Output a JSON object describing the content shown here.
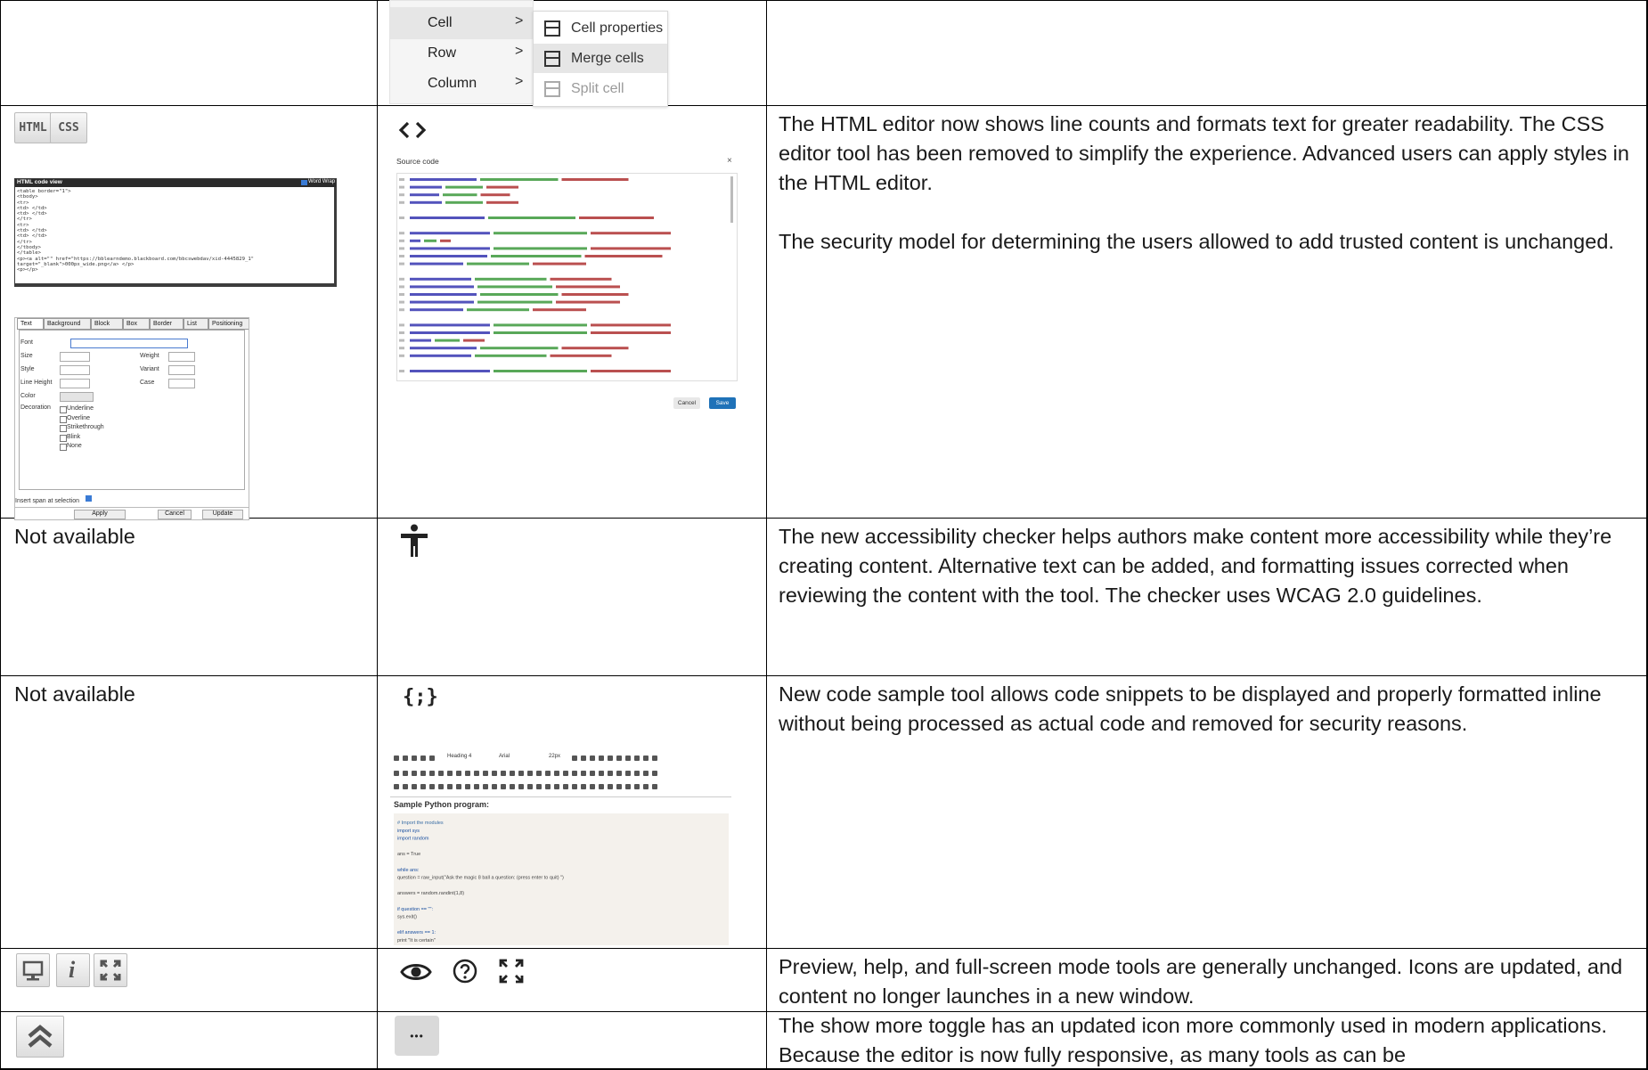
{
  "menu": {
    "items": [
      "Cell",
      "Row",
      "Column"
    ],
    "submenu": [
      "Cell properties",
      "Merge cells",
      "Split cell"
    ]
  },
  "rows": [
    {
      "old_icons": [
        "HTML",
        "CSS"
      ],
      "old_code_view": {
        "title": "HTML code view",
        "word_wrap": "Word Wrap",
        "lines": [
          "<table border=\"1\">",
          "<tbody>",
          "<tr>",
          "<td> </td>",
          "<td> </td>",
          "</tr>",
          "<tr>",
          "<td> </td>",
          "<td> </td>",
          "</tr>",
          "</tbody>",
          "</table>",
          "<p><a alt=\"\" href=\"https://bblearndemo.blackboard.com/bbcswebdav/xid-4445829_1\"",
          "target=\"_blank\">000px_wide.png</a> </p>",
          "<p></p>"
        ]
      },
      "old_css_editor": {
        "tabs": [
          "Text",
          "Background",
          "Block",
          "Box",
          "Border",
          "List",
          "Positioning"
        ],
        "fields": [
          "Font",
          "Size",
          "Style",
          "Line Height",
          "Color",
          "Decoration"
        ],
        "right_fields": [
          "Weight",
          "Variant",
          "Case"
        ],
        "decorations": [
          "Underline",
          "Overline",
          "Strikethrough",
          "Blink",
          "None"
        ],
        "insert_span": "Insert span at selection",
        "buttons": [
          "Apply",
          "Cancel",
          "Update"
        ]
      },
      "new_icon": "code-brackets-icon",
      "source_code": {
        "title": "Source code",
        "close": "×",
        "cancel": "Cancel",
        "save": "Save"
      },
      "description": [
        "The HTML editor now shows line counts and formats text for greater readability. The CSS editor tool has been removed to simplify the experience. Advanced users can apply styles in the HTML editor.",
        "The security model for determining the users allowed to add trusted content is unchanged."
      ]
    },
    {
      "old": "Not available",
      "new_icon": "accessibility-icon",
      "description": "The new accessibility checker helps authors make content more accessibility while they’re creating content. Alternative text can be added, and formatting issues corrected when reviewing the content with the tool. The checker uses WCAG 2.0 guidelines."
    },
    {
      "old": "Not available",
      "new_icon": "code-sample-icon",
      "editor": {
        "format": "Heading 4",
        "font": "Arial",
        "size": "22px",
        "heading": "Sample Python program:",
        "code_lines": [
          "# Import the modules",
          "import sys",
          "import random",
          "",
          "ans = True",
          "",
          "while ans:",
          "    question = raw_input(\"Ask the magic 8 ball a question: (press enter to quit) \")",
          "",
          "    answers = random.randint(1,8)",
          "",
          "    if question == \"\":",
          "        sys.exit()",
          "",
          "    elif answers == 1:",
          "        print \"It is certain\""
        ]
      },
      "description": "New code sample tool allows code snippets to be displayed and properly formatted inline without being processed as actual code and removed for security reasons."
    },
    {
      "old_icons": [
        "preview-monitor-icon",
        "info-icon",
        "fullscreen-icon"
      ],
      "new_icons": [
        "eye-icon",
        "help-icon",
        "fullscreen-icon"
      ],
      "description": "Preview, help, and full-screen mode tools are generally unchanged. Icons are updated, and content no longer launches in a new window."
    },
    {
      "old_icon": "double-chevron-up-icon",
      "new_icon": "more-ellipsis-icon",
      "new_label": "•••",
      "description": "The show more toggle has an updated icon more commonly used in modern applications. Because the editor is now fully responsive, as many tools as can be"
    }
  ]
}
